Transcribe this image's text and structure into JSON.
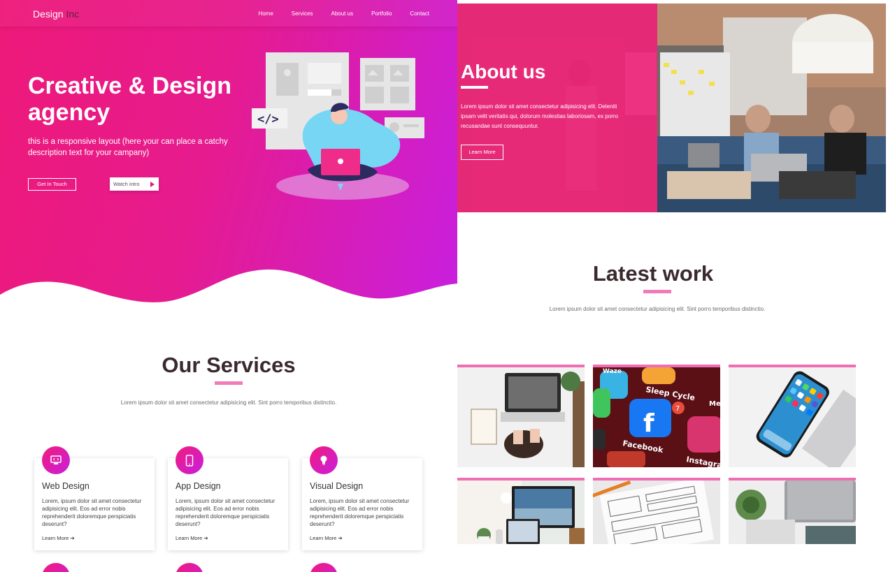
{
  "navbar": {
    "logo_main": "Design",
    "logo_accent": "Inc",
    "items": [
      "Home",
      "Services",
      "About us",
      "Portfolio",
      "Contact"
    ]
  },
  "hero": {
    "title": "Creative & Design agency",
    "description": "this is a responsive layout (here your can place a catchy description text for your campany)",
    "cta_primary": "Get In Touch",
    "cta_secondary": "Watch intro",
    "illustration_code": "</>"
  },
  "services": {
    "title": "Our Services",
    "subtitle": "Lorem ipsum dolor sit amet consectetur adipisicing elit. Sint porro temporibus distinctio.",
    "cards": [
      {
        "name": "Web Design",
        "icon": "monitor-code-icon",
        "text": "Lorem, ipsum dolor sit amet consectetur adipisicing elit. Eos ad error nobis reprehenderit doloremque perspiciatis deserunt?",
        "link": "Learn More ➔"
      },
      {
        "name": "App Design",
        "icon": "mobile-phone-icon",
        "text": "Lorem, ipsum dolor sit amet consectetur adipisicing elit. Eos ad error nobis reprehenderit doloremque perspiciatis deserunt?",
        "link": "Learn More ➔"
      },
      {
        "name": "Visual Design",
        "icon": "lightbulb-icon",
        "text": "Lorem, ipsum dolor sit amet consectetur adipisicing elit. Eos ad error nobis reprehenderit doloremque perspiciatis deserunt?",
        "link": "Learn More ➔"
      }
    ]
  },
  "about": {
    "title": "About us",
    "text": "Lorem ipsum dolor sit amet consectetur adipisicing elit. Deleniti ipsam velit veritatis qui, dolorum molestias laboriosam, ex porro recusandae sunt consequuntur.",
    "button": "Learn More"
  },
  "work": {
    "title": "Latest work",
    "subtitle": "Lorem ipsum dolor sit amet consectetur adipisicing elit. Sint porro temporibus distinctio.",
    "tiles": [
      "laptop-desk-photo",
      "social-apps-photo",
      "smartphone-photo",
      "desk-monitor-photo",
      "sketch-paper-photo",
      "plant-laptop-photo"
    ],
    "app_labels": [
      "Waze",
      "Sleep Cycle",
      "Facebook",
      "Instagram",
      "Mes"
    ],
    "notification_count": "7"
  },
  "colors": {
    "brand_pink": "#ee1a79",
    "brand_purple": "#c81fe0",
    "accent_underline": "#f07bb8",
    "heading_dark": "#3b2a2d"
  }
}
